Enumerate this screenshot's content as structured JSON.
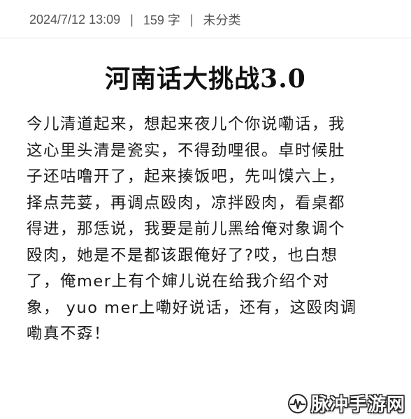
{
  "meta": {
    "date": "2024/7/12 13:09",
    "separator": "|",
    "word_count": "159 字",
    "category": "未分类"
  },
  "article": {
    "title": "河南话大挑战3.0",
    "lines": [
      "今儿清道起来，想起来夜儿个你说嘞话，我",
      "这心里头清是瓷实，不得劲哩很。卓时候肚",
      "子还咕噜开了，起来揍饭吧，先叫馍六上，",
      "择点芫荽，再调点殴肉，凉拌殴肉，看桌都",
      "得进，那恁说，我要是前儿黑给俺对象调个",
      "殴肉，她是不是都该跟俺好了?哎，也白想",
      "了，俺mer上有个婶儿说在给我介绍个对",
      "象，  yuo mer上嘞好说话，还有，这殴肉调",
      "嘞真不孬！"
    ]
  },
  "watermark": {
    "text": "脉冲手游网",
    "icon": "wave-logo-icon"
  }
}
